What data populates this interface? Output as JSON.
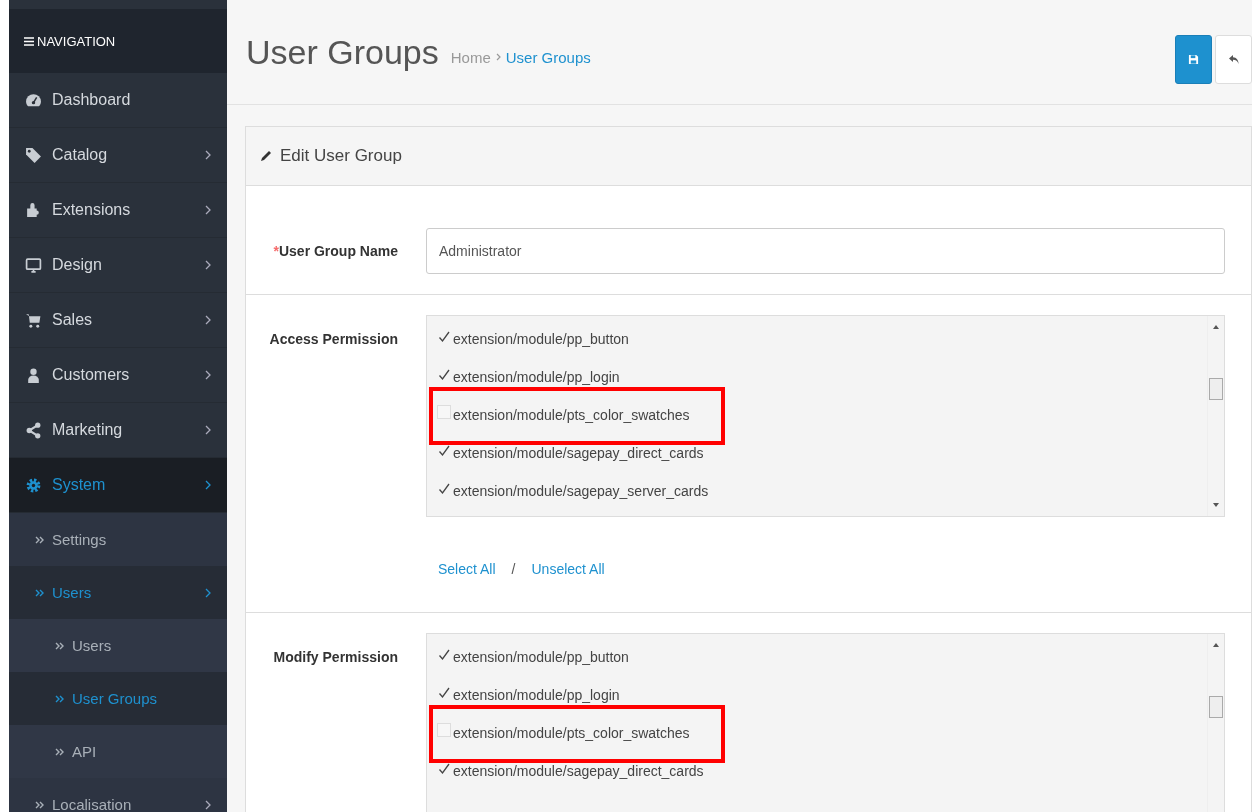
{
  "sidebar": {
    "header": "NAVIGATION",
    "items": [
      {
        "label": "Dashboard",
        "kind": "dashboard",
        "submenu": false,
        "selected": false
      },
      {
        "label": "Catalog",
        "kind": "tag",
        "submenu": true,
        "selected": false
      },
      {
        "label": "Extensions",
        "kind": "puzzle",
        "submenu": true,
        "selected": false
      },
      {
        "label": "Design",
        "kind": "monitor",
        "submenu": true,
        "selected": false
      },
      {
        "label": "Sales",
        "kind": "cart",
        "submenu": true,
        "selected": false
      },
      {
        "label": "Customers",
        "kind": "user",
        "submenu": true,
        "selected": false
      },
      {
        "label": "Marketing",
        "kind": "share",
        "submenu": true,
        "selected": false
      },
      {
        "label": "System",
        "kind": "gear",
        "submenu": true,
        "selected": true,
        "children": [
          {
            "label": "Settings",
            "submenu": false,
            "selected": false
          },
          {
            "label": "Users",
            "submenu": true,
            "selected": true,
            "children": [
              {
                "label": "Users",
                "submenu": false,
                "selected": false
              },
              {
                "label": "User Groups",
                "submenu": false,
                "selected": true
              },
              {
                "label": "API",
                "submenu": false,
                "selected": false
              }
            ]
          },
          {
            "label": "Localisation",
            "submenu": true,
            "selected": false
          }
        ]
      }
    ]
  },
  "page": {
    "title": "User Groups",
    "breadcrumb": [
      {
        "label": "Home",
        "selected": false
      },
      {
        "label": "User Groups",
        "selected": true
      }
    ]
  },
  "panel": {
    "title": "Edit User Group",
    "name_field": {
      "label": "User Group Name",
      "required_mark": "*",
      "value": "Administrator"
    },
    "permissions": [
      {
        "label": "Access Permission",
        "items": [
          {
            "label": "extension/module/pp_button",
            "checked": true,
            "highlighted": false
          },
          {
            "label": "extension/module/pp_login",
            "checked": true,
            "highlighted": false
          },
          {
            "label": "extension/module/pts_color_swatches",
            "checked": false,
            "highlighted": true
          },
          {
            "label": "extension/module/sagepay_direct_cards",
            "checked": true,
            "highlighted": false
          },
          {
            "label": "extension/module/sagepay_server_cards",
            "checked": true,
            "highlighted": false
          }
        ],
        "select_all": "Select All",
        "separator": "/",
        "unselect_all": "Unselect All"
      },
      {
        "label": "Modify Permission",
        "items": [
          {
            "label": "extension/module/pp_button",
            "checked": true,
            "highlighted": false
          },
          {
            "label": "extension/module/pp_login",
            "checked": true,
            "highlighted": false
          },
          {
            "label": "extension/module/pts_color_swatches",
            "checked": false,
            "highlighted": true
          },
          {
            "label": "extension/module/sagepay_direct_cards",
            "checked": true,
            "highlighted": false
          }
        ]
      }
    ]
  }
}
